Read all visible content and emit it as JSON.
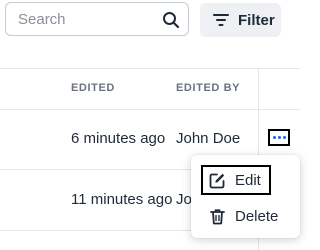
{
  "search": {
    "placeholder": "Search",
    "value": ""
  },
  "filter": {
    "label": "Filter"
  },
  "table": {
    "columns": {
      "edited": "EDITED",
      "edited_by": "EDITED BY"
    },
    "rows": [
      {
        "edited": "6 minutes ago",
        "edited_by": "John Doe"
      },
      {
        "edited": "11 minutes ago",
        "edited_by": "John Doe"
      }
    ]
  },
  "context_menu": {
    "items": [
      {
        "label": "Edit",
        "icon": "edit-icon"
      },
      {
        "label": "Delete",
        "icon": "trash-icon"
      }
    ]
  },
  "colors": {
    "accent": "#2563eb",
    "text": "#1f2937",
    "muted": "#6b7280",
    "border": "#e3e6ea"
  }
}
